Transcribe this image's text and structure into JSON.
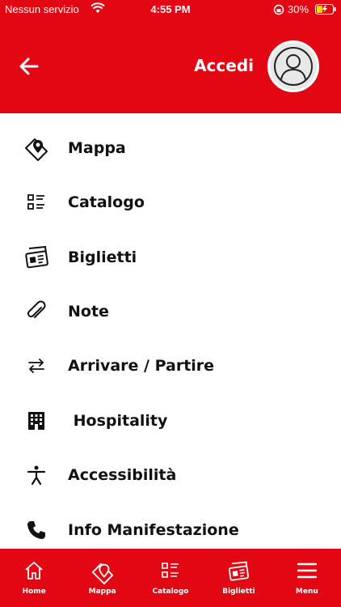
{
  "status_bar": {
    "carrier": "Nessun servizio",
    "time": "4:55 PM",
    "battery_percent": "30%"
  },
  "header": {
    "login_label": "Accedi"
  },
  "menu": {
    "items": [
      {
        "label": "Mappa",
        "icon": "map-pin-icon"
      },
      {
        "label": "Catalogo",
        "icon": "list-icon"
      },
      {
        "label": "Biglietti",
        "icon": "ticket-icon"
      },
      {
        "label": "Note",
        "icon": "paperclip-icon"
      },
      {
        "label": "Arrivare / Partire",
        "icon": "swap-arrows-icon"
      },
      {
        "label": " Hospitality",
        "icon": "building-icon"
      },
      {
        "label": "Accessibilità",
        "icon": "accessibility-icon"
      },
      {
        "label": "Info Manifestazione",
        "icon": "phone-icon"
      }
    ]
  },
  "tab_bar": {
    "tabs": [
      {
        "label": "Home",
        "icon": "home-icon"
      },
      {
        "label": "Mappa",
        "icon": "map-pin-icon"
      },
      {
        "label": "Catalogo",
        "icon": "list-icon"
      },
      {
        "label": "Biglietti",
        "icon": "ticket-icon"
      },
      {
        "label": "Menu",
        "icon": "hamburger-icon"
      }
    ],
    "active": "Menu"
  },
  "colors": {
    "brand_red": "#e30613",
    "text": "#111111",
    "background": "#ffffff"
  }
}
